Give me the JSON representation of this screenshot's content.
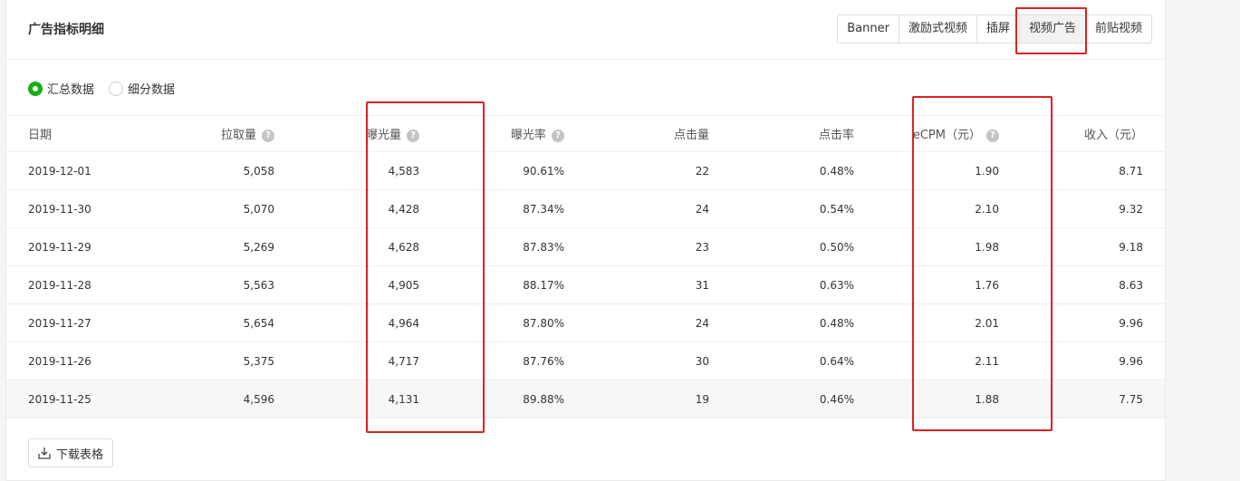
{
  "card": {
    "title": "广告指标明细"
  },
  "tabs": [
    {
      "label": "Banner",
      "active": false
    },
    {
      "label": "激励式视频",
      "active": false
    },
    {
      "label": "插屏",
      "active": false
    },
    {
      "label": "视频广告",
      "active": true
    },
    {
      "label": "前贴视频",
      "active": false
    }
  ],
  "view_mode": {
    "options": [
      {
        "label": "汇总数据",
        "selected": true
      },
      {
        "label": "细分数据",
        "selected": false
      }
    ]
  },
  "table": {
    "columns": [
      {
        "label": "日期",
        "help": false
      },
      {
        "label": "拉取量",
        "help": true
      },
      {
        "label": "曝光量",
        "help": true
      },
      {
        "label": "曝光率",
        "help": true
      },
      {
        "label": "点击量",
        "help": false
      },
      {
        "label": "点击率",
        "help": false
      },
      {
        "label": "eCPM（元）",
        "help": true
      },
      {
        "label": "收入（元）",
        "help": false
      }
    ],
    "rows": [
      [
        "2019-12-01",
        "5,058",
        "4,583",
        "90.61%",
        "22",
        "0.48%",
        "1.90",
        "8.71"
      ],
      [
        "2019-11-30",
        "5,070",
        "4,428",
        "87.34%",
        "24",
        "0.54%",
        "2.10",
        "9.32"
      ],
      [
        "2019-11-29",
        "5,269",
        "4,628",
        "87.83%",
        "23",
        "0.50%",
        "1.98",
        "9.18"
      ],
      [
        "2019-11-28",
        "5,563",
        "4,905",
        "88.17%",
        "31",
        "0.63%",
        "1.76",
        "8.63"
      ],
      [
        "2019-11-27",
        "5,654",
        "4,964",
        "87.80%",
        "24",
        "0.48%",
        "2.01",
        "9.96"
      ],
      [
        "2019-11-26",
        "5,375",
        "4,717",
        "87.76%",
        "30",
        "0.64%",
        "2.11",
        "9.96"
      ],
      [
        "2019-11-25",
        "4,596",
        "4,131",
        "89.88%",
        "19",
        "0.46%",
        "1.88",
        "7.75"
      ]
    ]
  },
  "download": {
    "label": "下载表格",
    "icon": "download-icon"
  },
  "help_icon": {
    "glyph": "?"
  },
  "colors": {
    "accent": "#1aad19",
    "highlight": "#e02020"
  }
}
